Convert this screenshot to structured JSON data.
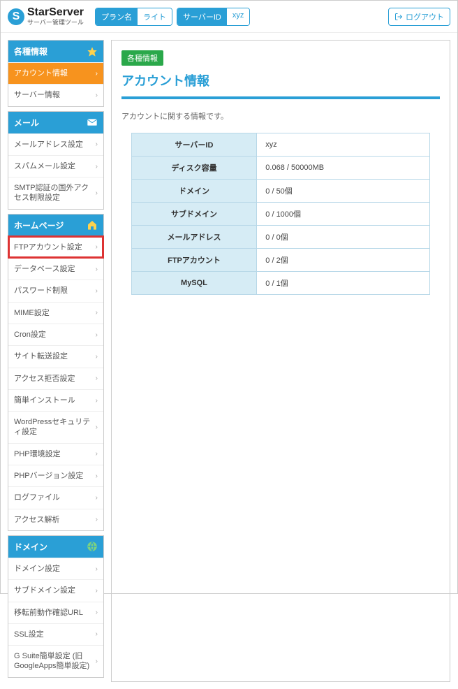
{
  "header": {
    "brand": "StarServer",
    "brand_sub": "サーバー管理ツール",
    "plan_label": "プラン名",
    "plan_value": "ライト",
    "server_label": "サーバーID",
    "server_value": "xyz",
    "logout": "ログアウト"
  },
  "sidebar": {
    "info": {
      "header": "各種情報",
      "items": [
        {
          "label": "アカウント情報"
        },
        {
          "label": "サーバー情報"
        }
      ]
    },
    "mail": {
      "header": "メール",
      "items": [
        {
          "label": "メールアドレス設定"
        },
        {
          "label": "スパムメール設定"
        },
        {
          "label": "SMTP認証の国外アクセス制限設定"
        }
      ]
    },
    "homepage": {
      "header": "ホームページ",
      "items": [
        {
          "label": "FTPアカウント設定"
        },
        {
          "label": "データベース設定"
        },
        {
          "label": "パスワード制限"
        },
        {
          "label": "MIME設定"
        },
        {
          "label": "Cron設定"
        },
        {
          "label": "サイト転送設定"
        },
        {
          "label": "アクセス拒否設定"
        },
        {
          "label": "簡単インストール"
        },
        {
          "label": "WordPressセキュリティ設定"
        },
        {
          "label": "PHP環境設定"
        },
        {
          "label": "PHPバージョン設定"
        },
        {
          "label": "ログファイル"
        },
        {
          "label": "アクセス解析"
        }
      ]
    },
    "domain": {
      "header": "ドメイン",
      "items": [
        {
          "label": "ドメイン設定"
        },
        {
          "label": "サブドメイン設定"
        },
        {
          "label": "移転前動作確認URL"
        },
        {
          "label": "SSL設定"
        },
        {
          "label": "G Suite簡単設定 (旧GoogleApps簡単設定)"
        }
      ]
    }
  },
  "main": {
    "badge": "各種情報",
    "title": "アカウント情報",
    "desc": "アカウントに関する情報です。",
    "table": [
      {
        "key": "サーバーID",
        "value": "xyz"
      },
      {
        "key": "ディスク容量",
        "value": "0.068 / 50000MB"
      },
      {
        "key": "ドメイン",
        "value": "0 / 50個"
      },
      {
        "key": "サブドメイン",
        "value": "0 / 1000個"
      },
      {
        "key": "メールアドレス",
        "value": "0 / 0個"
      },
      {
        "key": "FTPアカウント",
        "value": "0 / 2個"
      },
      {
        "key": "MySQL",
        "value": "0 / 1個"
      }
    ]
  }
}
